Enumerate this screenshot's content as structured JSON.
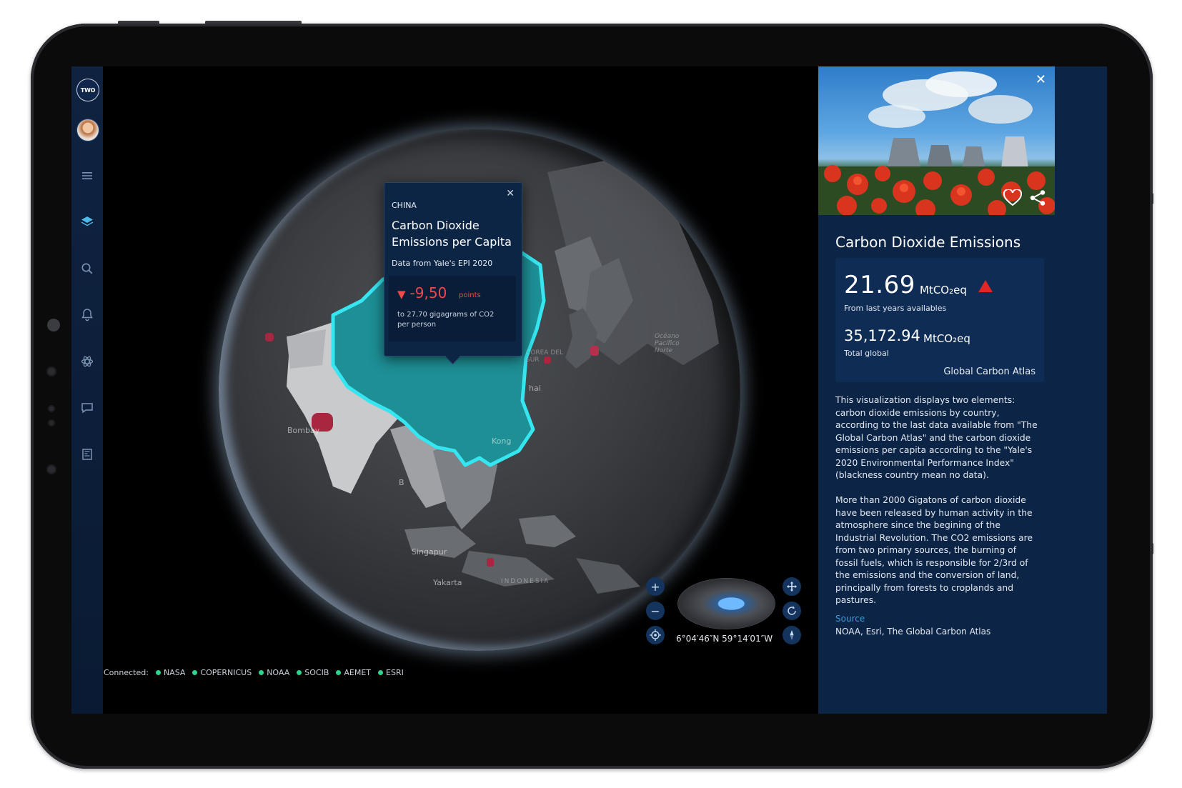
{
  "rail": {
    "logo_text": "TWO"
  },
  "popup": {
    "country": "CHINA",
    "title": "Carbon Dioxide Emissions per Capita",
    "source": "Data from Yale's EPI 2020",
    "delta": "-9,50",
    "delta_unit": "points",
    "description": "to 27,70 gigagrams of CO2 per person",
    "close_glyph": "✕"
  },
  "map_labels": {
    "bombay": "Bombay",
    "hong_kong": "Kong",
    "shanghai": "hai",
    "korea": "COREA DEL SUR",
    "singapore": "Singapur",
    "jakarta": "Yakarta",
    "indonesia": "INDONESIA",
    "ocean": "Océano Pacífico Norte",
    "b": "B"
  },
  "controls": {
    "zoom_in": "+",
    "zoom_out": "−",
    "coords": "6°04′46″N 59°14′01″W"
  },
  "connected": {
    "label": "Connected:",
    "sources": [
      "NASA",
      "COPERNICUS",
      "NOAA",
      "SOCIB",
      "AEMET",
      "ESRI"
    ]
  },
  "panel": {
    "close_glyph": "✕",
    "title": "Carbon Dioxide Emissions",
    "value_main": "21.69",
    "unit_main": "MtCO₂eq",
    "label_main": "From last years availables",
    "value_total": "35,172.94",
    "unit_total": "MtCO₂eq",
    "label_total": "Total global",
    "atlas": "Global Carbon Atlas",
    "paragraph1": "This visualization displays two elements: carbon dioxide emissions by country, according to the last data available from \"The Global Carbon Atlas\" and the carbon dioxide emissions per capita according to the \"Yale's 2020 Environmental Performance Index\" (blackness country mean no data).",
    "paragraph2": "More than 2000 Gigatons of carbon dioxide have been released by human activity in the atmosphere since the begining of the Industrial Revolution. The CO2 emissions are from two primary sources, the burning of fossil fuels, which is responsible for 2/3rd of the emissions and the conversion of land, principally from forests to croplands and pastures.",
    "source_label": "Source",
    "source_value": "NOAA, Esri, The Global Carbon Atlas"
  },
  "colors": {
    "accent": "#4fb8e8",
    "china_fill": "#1d8f95",
    "china_outline": "#35e6f0",
    "negative": "#ee4a4a",
    "increase": "#e22626",
    "connected_dot": "#2ed38f"
  },
  "icons": [
    "two-logo",
    "avatar",
    "menu-icon",
    "layers-icon",
    "search-icon",
    "bell-icon",
    "atom-icon",
    "chat-icon",
    "news-icon",
    "heart-icon",
    "share-icon",
    "close-icon",
    "move-icon",
    "rotate-icon",
    "compass-icon",
    "locate-icon"
  ]
}
